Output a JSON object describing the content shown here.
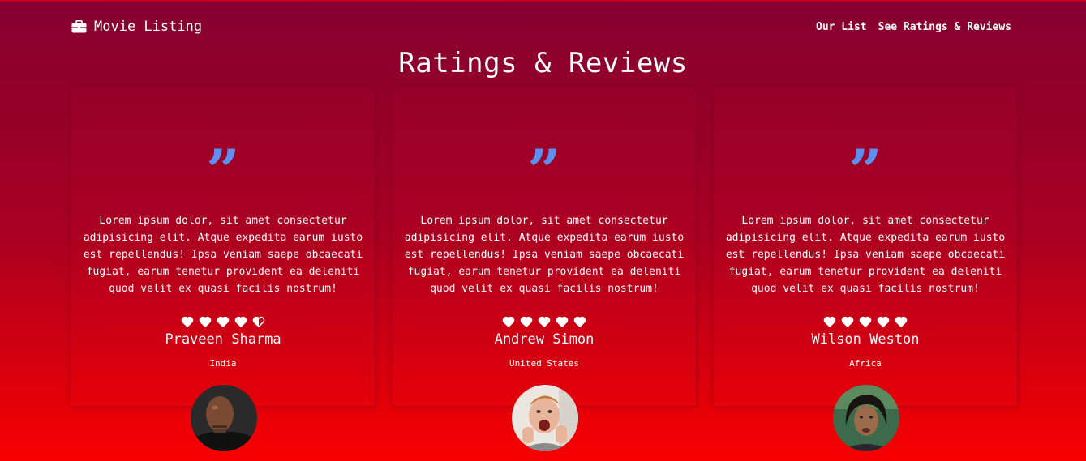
{
  "nav": {
    "brand_label": "Movie Listing",
    "brand_icon": "briefcase-icon",
    "links": [
      {
        "label": "Our List"
      },
      {
        "label": "See Ratings & Reviews"
      }
    ]
  },
  "page": {
    "title": "Ratings & Reviews"
  },
  "colors": {
    "gradient_top": "#850030",
    "gradient_bottom": "#f80000",
    "quote_mark": "#5e8ff0",
    "text": "#ffffff"
  },
  "reviews": [
    {
      "quote_glyph": "”",
      "text": "Lorem ipsum dolor, sit amet consectetur adipisicing elit. Atque expedita earum iusto est repellendus! Ipsa veniam saepe obcaecati fugiat, earum tenetur provident ea deleniti quod velit ex quasi facilis nostrum!",
      "rating": 4.5,
      "rating_max": 5,
      "rating_icon": "heart-icon",
      "name": "Praveen Sharma",
      "location": "India"
    },
    {
      "quote_glyph": "”",
      "text": "Lorem ipsum dolor, sit amet consectetur adipisicing elit. Atque expedita earum iusto est repellendus! Ipsa veniam saepe obcaecati fugiat, earum tenetur provident ea deleniti quod velit ex quasi facilis nostrum!",
      "rating": 5,
      "rating_max": 5,
      "rating_icon": "heart-icon",
      "name": "Andrew Simon",
      "location": "United States"
    },
    {
      "quote_glyph": "”",
      "text": "Lorem ipsum dolor, sit amet consectetur adipisicing elit. Atque expedita earum iusto est repellendus! Ipsa veniam saepe obcaecati fugiat, earum tenetur provident ea deleniti quod velit ex quasi facilis nostrum!",
      "rating": 5,
      "rating_max": 5,
      "rating_icon": "heart-icon",
      "name": "Wilson Weston",
      "location": "Africa"
    }
  ]
}
